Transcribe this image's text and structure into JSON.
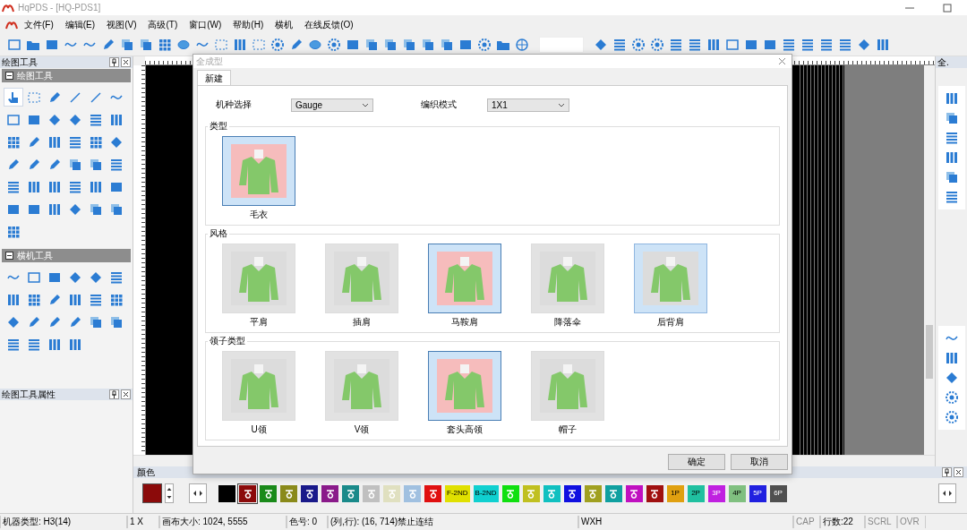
{
  "app": {
    "title": "HqPDS - [HQ-PDS1]"
  },
  "menu": [
    "文件(F)",
    "编辑(E)",
    "视图(V)",
    "高级(T)",
    "窗口(W)",
    "帮助(H)",
    "横机",
    "在线反馈(O)"
  ],
  "left_panel": {
    "title": "绘图工具",
    "sections": [
      {
        "title": "绘图工具",
        "expanded": true,
        "tools": [
          {
            "selected": true
          },
          {
            "selected": false
          },
          {
            "selected": false
          },
          {
            "selected": false
          },
          {
            "selected": false
          },
          {
            "selected": false
          },
          {
            "selected": false
          },
          {
            "selected": false
          },
          {
            "selected": false
          },
          {
            "selected": false
          },
          {
            "selected": false
          },
          {
            "selected": false
          },
          {
            "selected": false
          },
          {
            "selected": false
          },
          {
            "selected": false
          },
          {
            "selected": false
          },
          {
            "selected": false
          },
          {
            "selected": false
          },
          {
            "selected": false
          },
          {
            "selected": false
          },
          {
            "selected": false
          },
          {
            "selected": false
          },
          {
            "selected": false
          },
          {
            "selected": false
          },
          {
            "selected": false
          },
          {
            "selected": false
          },
          {
            "selected": false
          },
          {
            "selected": false
          },
          {
            "selected": false
          },
          {
            "selected": false
          },
          {
            "selected": false
          },
          {
            "selected": false
          },
          {
            "selected": false
          },
          {
            "selected": false
          },
          {
            "selected": false
          },
          {
            "selected": false
          },
          {
            "selected": false
          }
        ]
      },
      {
        "title": "横机工具",
        "expanded": true,
        "tools": [
          {
            "selected": false
          },
          {
            "selected": false
          },
          {
            "selected": false
          },
          {
            "selected": false
          },
          {
            "selected": false
          },
          {
            "selected": false
          },
          {
            "selected": false
          },
          {
            "selected": false
          },
          {
            "selected": false
          },
          {
            "selected": false
          },
          {
            "selected": false
          },
          {
            "selected": false
          },
          {
            "selected": false
          },
          {
            "selected": false
          },
          {
            "selected": false
          },
          {
            "selected": false
          },
          {
            "selected": false
          },
          {
            "selected": false
          },
          {
            "selected": false
          },
          {
            "selected": false
          },
          {
            "selected": false
          },
          {
            "selected": false
          }
        ]
      }
    ]
  },
  "properties_panel": {
    "title": "绘图工具属性"
  },
  "right_panel": {
    "title": "全."
  },
  "dialog": {
    "title": "全成型",
    "tabs": [
      {
        "label": "新建",
        "selected": true
      }
    ],
    "machine_label": "机种选择",
    "machine_value": "Gauge",
    "mode_label": "编织模式",
    "mode_value": "1X1",
    "groups": [
      {
        "title": "类型",
        "items": [
          {
            "label": "毛衣",
            "selected": true,
            "highlighted": false
          }
        ]
      },
      {
        "title": "风格",
        "items": [
          {
            "label": "平肩",
            "selected": false,
            "highlighted": false
          },
          {
            "label": "插肩",
            "selected": false,
            "highlighted": false
          },
          {
            "label": "马鞍肩",
            "selected": true,
            "highlighted": false
          },
          {
            "label": "降落伞",
            "selected": false,
            "highlighted": false
          },
          {
            "label": "后背肩",
            "selected": false,
            "highlighted": true
          }
        ]
      },
      {
        "title": "领子类型",
        "items": [
          {
            "label": "U领",
            "selected": false,
            "highlighted": false
          },
          {
            "label": "V领",
            "selected": false,
            "highlighted": false
          },
          {
            "label": "套头高领",
            "selected": true,
            "highlighted": false
          },
          {
            "label": "帽子",
            "selected": false,
            "highlighted": false
          }
        ]
      }
    ],
    "buttons": [
      "确定",
      "取消"
    ]
  },
  "color_panel": {
    "title": "颜色",
    "swatches": [
      {
        "color": "#000000",
        "selected": false
      },
      {
        "color": "#8b0a0a",
        "selected": true
      },
      {
        "color": "#1a8a1a",
        "selected": false
      },
      {
        "color": "#8a8a1a",
        "selected": false
      },
      {
        "color": "#1a1a8a",
        "selected": false
      },
      {
        "color": "#8a1a8a",
        "selected": false
      },
      {
        "color": "#1a8a8a",
        "selected": false
      },
      {
        "color": "#c0c0c0",
        "selected": false
      },
      {
        "color": "#e0e0c0",
        "selected": false
      },
      {
        "color": "#a0c0e0",
        "selected": false
      },
      {
        "color": "#e01010",
        "selected": false
      },
      {
        "color": "#e0e000",
        "label": "F-2ND",
        "selected": false
      },
      {
        "color": "#10d0d0",
        "label": "B-2ND",
        "selected": false
      },
      {
        "color": "#10e010",
        "selected": false
      },
      {
        "color": "#c0c020",
        "selected": false
      },
      {
        "color": "#10c0c0",
        "selected": false
      },
      {
        "color": "#1010e0",
        "selected": false
      },
      {
        "color": "#a0a020",
        "selected": false
      },
      {
        "color": "#10a0a0",
        "selected": false
      },
      {
        "color": "#c010c0",
        "selected": false
      },
      {
        "color": "#a01010",
        "selected": false
      },
      {
        "color": "#e0a010",
        "label": "1P",
        "selected": false
      },
      {
        "color": "#20c0a0",
        "label": "2P",
        "selected": false
      },
      {
        "color": "#c020e0",
        "label": "3P",
        "selected": false
      },
      {
        "color": "#80c080",
        "label": "4P",
        "selected": false
      },
      {
        "color": "#2020e0",
        "label": "5P",
        "selected": false
      },
      {
        "color": "#505050",
        "label": "6P",
        "selected": false
      }
    ]
  },
  "status_bar": [
    {
      "text": "机器类型: H3(14)",
      "dimmed": false
    },
    {
      "text": "1 X",
      "dimmed": false
    },
    {
      "text": "画布大小: 1024, 5555",
      "dimmed": false
    },
    {
      "text": "色号: 0",
      "dimmed": false
    },
    {
      "text": "(列,行): (16, 714)禁止连结",
      "dimmed": false
    },
    {
      "text": "WXH",
      "dimmed": false
    },
    {
      "text": "CAP",
      "dimmed": true
    },
    {
      "text": "行数:22",
      "dimmed": false
    },
    {
      "text": "SCRL",
      "dimmed": true
    },
    {
      "text": "OVR",
      "dimmed": true
    }
  ]
}
